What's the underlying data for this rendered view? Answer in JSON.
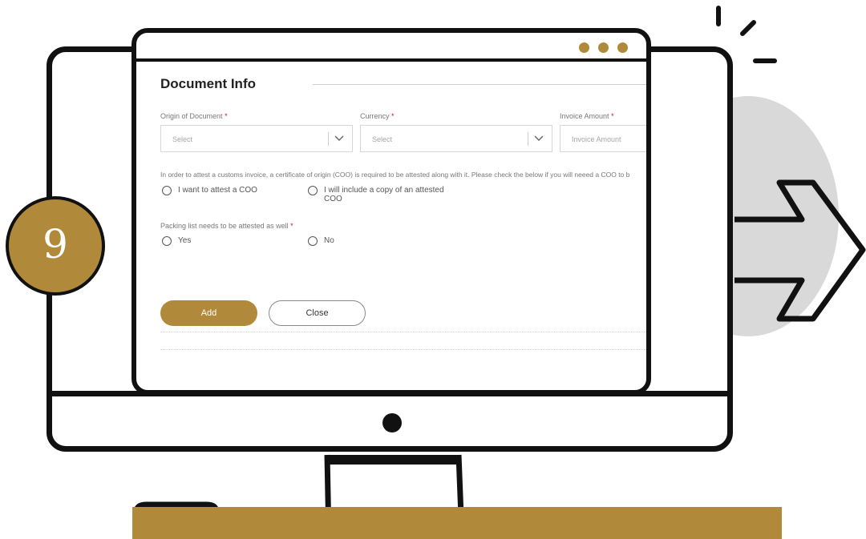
{
  "step_number": "9",
  "colors": {
    "accent": "#b08a3a",
    "outline": "#111111",
    "circle_gray": "#d9d9d9",
    "required": "#c8102e"
  },
  "form": {
    "title": "Document Info",
    "fields": [
      {
        "label": "Origin of Document",
        "required_mark": "*",
        "placeholder": "Select",
        "type": "select"
      },
      {
        "label": "Currency",
        "required_mark": "*",
        "placeholder": "Select",
        "type": "select"
      },
      {
        "label": "Invoice Amount",
        "required_mark": "*",
        "placeholder": "Invoice Amount",
        "type": "text"
      }
    ],
    "coo_note": "In order to attest a customs invoice, a certificate of origin (COO) is required to be attested along with it. Please check the below if you will neeed a COO to b",
    "coo_options": [
      "I want to attest a COO",
      "I will include a copy of an attested COO"
    ],
    "packing": {
      "label": "Packing list needs to be attested as well",
      "required_mark": "*",
      "options": [
        "Yes",
        "No"
      ]
    },
    "buttons": {
      "add": "Add",
      "close": "Close"
    }
  },
  "icons": [
    "chevron-down-icon",
    "arrow-right-icon",
    "spark-lines-icon",
    "browser-dots-icon"
  ]
}
